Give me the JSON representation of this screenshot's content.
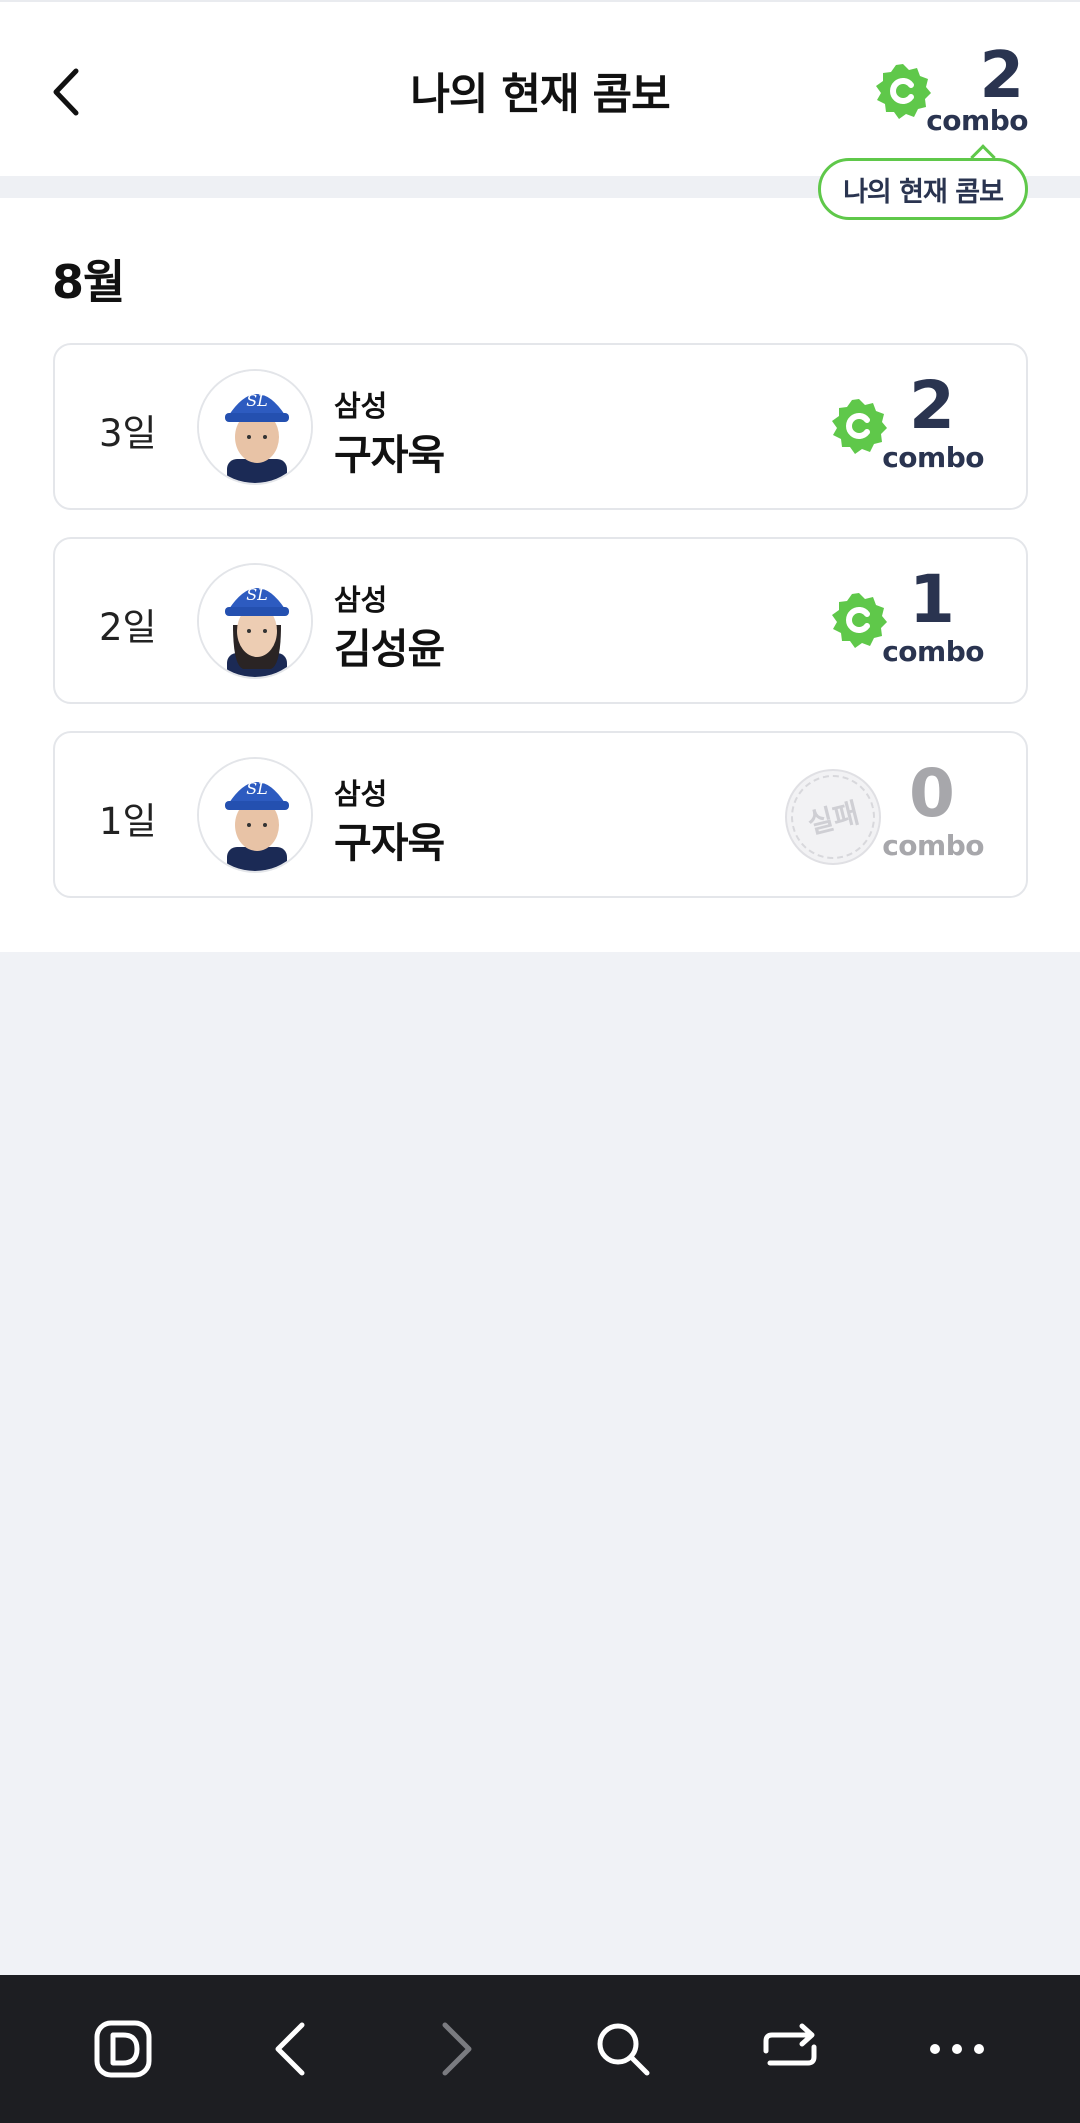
{
  "header": {
    "title": "나의 현재 콤보",
    "combo_count": "2",
    "combo_label": "combo"
  },
  "tooltip": {
    "text": "나의 현재 콤보"
  },
  "month": "8월",
  "entries": [
    {
      "day": "3일",
      "team": "삼성",
      "player": "구자욱",
      "combo": "2",
      "combo_label": "combo",
      "status": "success"
    },
    {
      "day": "2일",
      "team": "삼성",
      "player": "김성윤",
      "combo": "1",
      "combo_label": "combo",
      "status": "success"
    },
    {
      "day": "1일",
      "team": "삼성",
      "player": "구자욱",
      "combo": "0",
      "combo_label": "combo",
      "status": "fail",
      "badge_text": "실패"
    }
  ],
  "colors": {
    "accent_green": "#5fc84a",
    "navy": "#2a3450",
    "gray_text": "#a7a7ab",
    "bottom_bar": "#1d1e22"
  },
  "bottom_bar": {
    "icons": [
      "browser-logo-icon",
      "back-arrow-icon",
      "forward-arrow-icon",
      "search-icon",
      "switch-icon",
      "more-icon"
    ]
  }
}
